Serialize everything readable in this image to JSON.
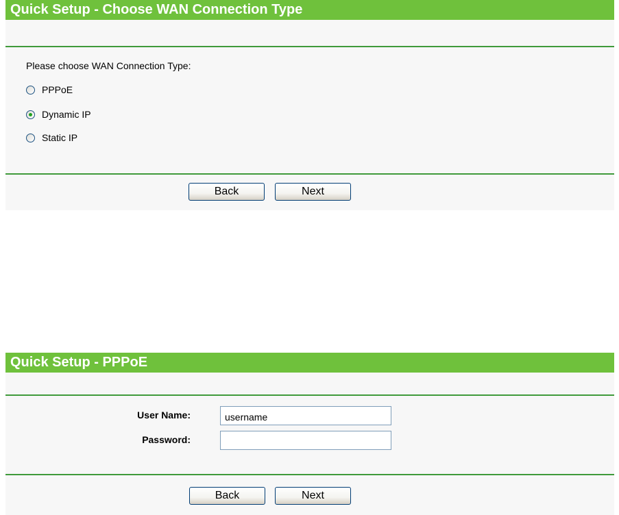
{
  "wan_panel": {
    "title": "Quick Setup - Choose WAN Connection Type",
    "prompt": "Please choose WAN Connection Type:",
    "options": [
      {
        "label": "PPPoE",
        "selected": false
      },
      {
        "label": "Dynamic IP",
        "selected": true
      },
      {
        "label": "Static IP",
        "selected": false
      }
    ],
    "back_label": "Back",
    "next_label": "Next"
  },
  "pppoe_panel": {
    "title": "Quick Setup - PPPoE",
    "username_label": "User Name:",
    "username_value": "username",
    "password_label": "Password:",
    "password_value": "",
    "back_label": "Back",
    "next_label": "Next"
  },
  "colors": {
    "title_bar": "#6fc13c",
    "divider": "#3f9a3a",
    "panel_background": "#f7f7f7"
  }
}
